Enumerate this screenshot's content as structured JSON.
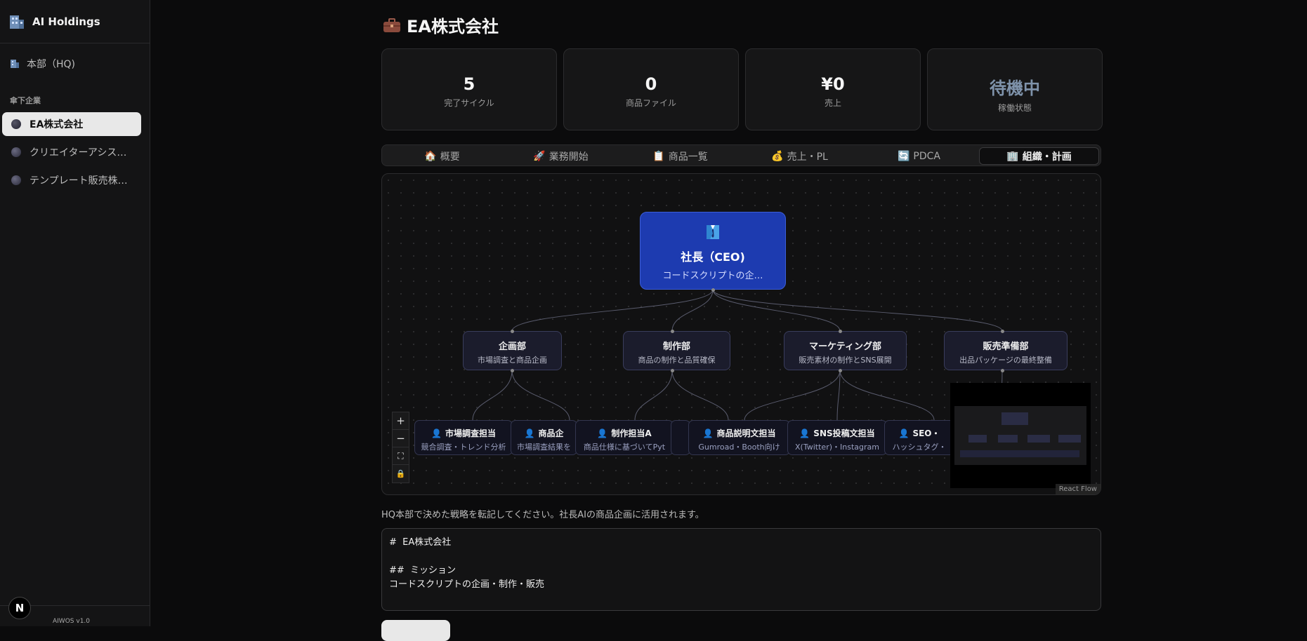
{
  "app": {
    "brand": "AI Holdings",
    "version": "AIWOS v1.0",
    "next_badge": "N"
  },
  "sidebar": {
    "hq_label": "本部（HQ)",
    "section_label": "傘下企業",
    "companies": [
      {
        "label": "EA株式会社",
        "active": true
      },
      {
        "label": "クリエイターアシス…",
        "active": false
      },
      {
        "label": "テンプレート販売株…",
        "active": false
      }
    ]
  },
  "page": {
    "title": "EA株式会社",
    "title_icon": "briefcase-icon"
  },
  "stats": [
    {
      "value": "5",
      "label": "完了サイクル"
    },
    {
      "value": "0",
      "label": "商品ファイル"
    },
    {
      "value": "¥0",
      "label": "売上"
    },
    {
      "value": "待機中",
      "label": "稼働状態"
    }
  ],
  "tabs": [
    {
      "icon": "🏠",
      "label": "概要"
    },
    {
      "icon": "🚀",
      "label": "業務開始"
    },
    {
      "icon": "📋",
      "label": "商品一覧"
    },
    {
      "icon": "💰",
      "label": "売上・PL"
    },
    {
      "icon": "🔄",
      "label": "PDCA"
    },
    {
      "icon": "🏢",
      "label": "組織・計画",
      "active": true
    }
  ],
  "org": {
    "ceo": {
      "title": "社長（CEO)",
      "subtitle": "コードスクリプトの企…"
    },
    "departments": [
      {
        "title": "企画部",
        "subtitle": "市場調査と商品企画"
      },
      {
        "title": "制作部",
        "subtitle": "商品の制作と品質確保"
      },
      {
        "title": "マーケティング部",
        "subtitle": "販売素材の制作とSNS展開"
      },
      {
        "title": "販売準備部",
        "subtitle": "出品パッケージの最終整備"
      }
    ],
    "agents": [
      {
        "title": "市場調査担当",
        "subtitle": "競合調査・トレンド分析"
      },
      {
        "title": "商品企",
        "subtitle": "市場調査結果を"
      },
      {
        "title": "制作担当A",
        "subtitle": "商品仕様に基づいてPyt"
      },
      {
        "title": "",
        "subtitle": ""
      },
      {
        "title": "商品説明文担当",
        "subtitle": "Gumroad・Booth向け"
      },
      {
        "title": "SNS投稿文担当",
        "subtitle": "X(Twitter)・Instagram"
      },
      {
        "title": "SEO・",
        "subtitle": "ハッシュタグ・"
      }
    ],
    "controls": [
      "+",
      "−",
      "⛶",
      "🔒"
    ],
    "attribution": "React Flow"
  },
  "strategy": {
    "hint": "HQ本部で決めた戦略を転記してください。社長AIの商品企画に活用されます。",
    "content": "#  EA株式会社\n\n##  ミッション\nコードスクリプトの企画・制作・販売"
  }
}
